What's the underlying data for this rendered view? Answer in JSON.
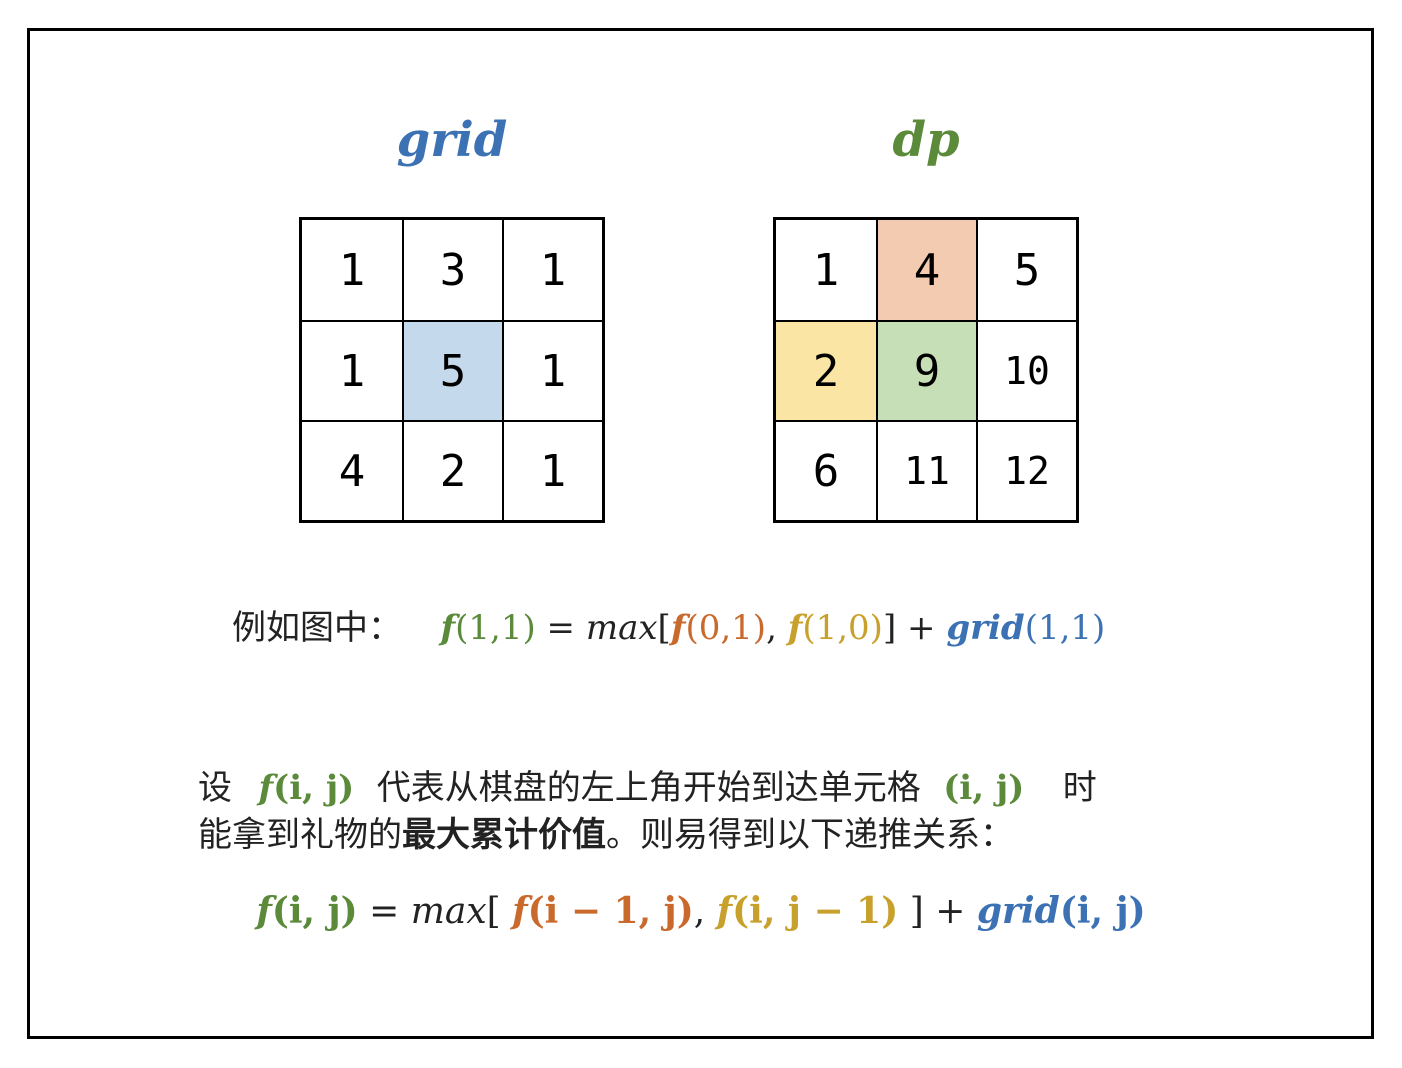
{
  "colors": {
    "blue": "#3c72b4",
    "green": "#5b8a3a",
    "orange": "#c9692c",
    "gold": "#c8a02c",
    "highlight_blue": "#c5d9ed",
    "highlight_orange": "#f2cbb0",
    "highlight_yellow": "#fae5a4",
    "highlight_green": "#c7dfb6"
  },
  "grid": {
    "title": "grid",
    "cells": [
      [
        "1",
        "3",
        "1"
      ],
      [
        "1",
        "5",
        "1"
      ],
      [
        "4",
        "2",
        "1"
      ]
    ],
    "highlight": {
      "row": 1,
      "col": 1,
      "color": "#c5d9ed"
    }
  },
  "dp": {
    "title": "dp",
    "cells": [
      [
        "1",
        "4",
        "5"
      ],
      [
        "2",
        "9",
        "10"
      ],
      [
        "6",
        "11",
        "12"
      ]
    ],
    "highlights": [
      {
        "row": 0,
        "col": 1,
        "color": "#f2cbb0"
      },
      {
        "row": 1,
        "col": 0,
        "color": "#fae5a4"
      },
      {
        "row": 1,
        "col": 1,
        "color": "#c7dfb6"
      }
    ]
  },
  "example": {
    "prefix": "例如图中：",
    "f": "f",
    "args_11": "(1,1)",
    "eq": " = ",
    "max": "max",
    "lbr": "[",
    "args_01": "(0,1)",
    "comma": ", ",
    "args_10": "(1,0)",
    "rbr": "]",
    "plus": " + ",
    "grid": "grid",
    "args_grid": "(1,1)"
  },
  "description": {
    "set": "设",
    "f": "f",
    "ij": "(i, j)",
    "middle": "代表从棋盘的左上角开始到达单元格",
    "ij2": "(i, j)",
    "time": "时",
    "line2_pre": "能拿到礼物的",
    "line2_bold": "最大累计价值",
    "line2_post": "。则易得到以下递推关系："
  },
  "recurrence": {
    "f": "f",
    "ij": "(i, j)",
    "eq": " = ",
    "max": "max",
    "lbr": "[ ",
    "term1": "(i − 1, j)",
    "comma": ", ",
    "term2": "(i, j − 1)",
    "rbr": " ]",
    "plus": " + ",
    "grid": "grid",
    "gij": "(i, j)"
  }
}
